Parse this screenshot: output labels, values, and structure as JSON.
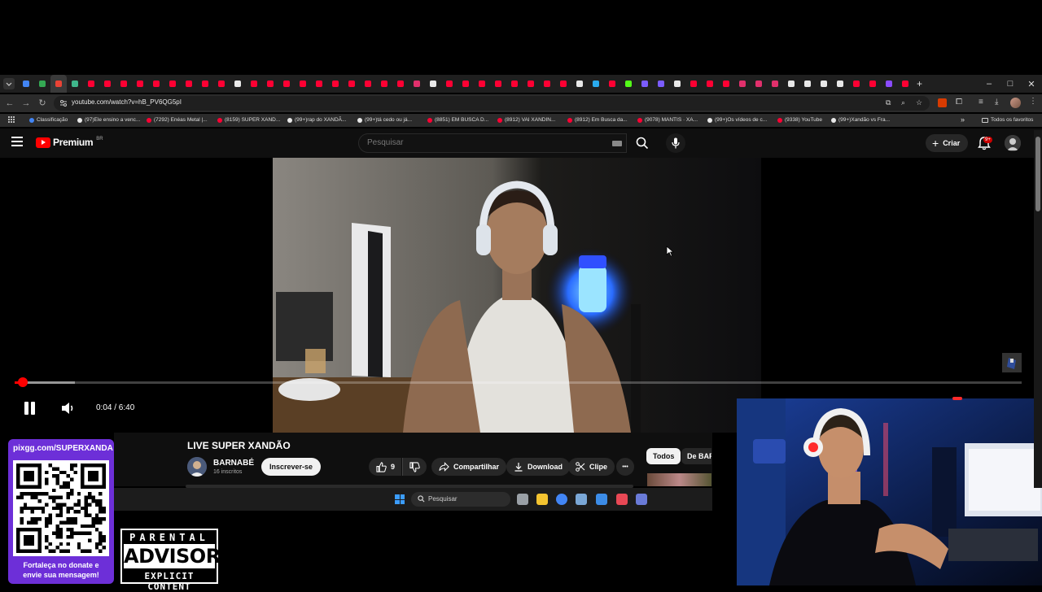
{
  "browser": {
    "tab_favicons": [
      "#4285f4",
      "#34a853",
      "#ea4335",
      "#3fb68b",
      "#ff0033",
      "#ff0033",
      "#ff0033",
      "#ff0033",
      "#ff0033",
      "#ff0033",
      "#ff0033",
      "#ff0033",
      "#ff0033",
      "#e8e8e8",
      "#ff0033",
      "#ff0033",
      "#ff0033",
      "#ff0033",
      "#ff0033",
      "#ff0033",
      "#ff0033",
      "#ff0033",
      "#ff0033",
      "#ff0033",
      "#e1306c",
      "#e8e8e8",
      "#ff0033",
      "#ff0033",
      "#ff0033",
      "#ff0033",
      "#ff0033",
      "#ff0033",
      "#ff0033",
      "#ff0033",
      "#e8e8e8",
      "#2aabee",
      "#ff0033",
      "#53fc18",
      "#7b5cff",
      "#7b5cff",
      "#e8e8e8",
      "#ff0033",
      "#ff0033",
      "#ff0033",
      "#e1306c",
      "#e1306c",
      "#e1306c",
      "#e8e8e8",
      "#e8e8e8",
      "#e8e8e8",
      "#e8e8e8",
      "#ff0033",
      "#ff0033",
      "#8a4bff",
      "#ff0033"
    ],
    "new_tab_label": "+",
    "window_controls": {
      "minimize": "–",
      "maximize": "□",
      "close": "✕"
    },
    "url": "youtube.com/watch?v=hB_PV6QG5pI",
    "bookmarks": [
      {
        "label": "Classificação",
        "color": "#4285f4"
      },
      {
        "label": "(97)Ele ensino a venc...",
        "color": "#e8e8e8"
      },
      {
        "label": "(7292) Enéas Metal |...",
        "color": "#ff0033"
      },
      {
        "label": "(8159) SUPER XAND...",
        "color": "#ff0033"
      },
      {
        "label": "(99+)rap do XANDÃ...",
        "color": "#e8e8e8"
      },
      {
        "label": "(99+)tá cedo ou já...",
        "color": "#e8e8e8"
      },
      {
        "label": "(8851) EM BUSCA D...",
        "color": "#ff0033"
      },
      {
        "label": "(8912) VAI XANDIN...",
        "color": "#ff0033"
      },
      {
        "label": "(8912) Em Busca da...",
        "color": "#ff0033"
      },
      {
        "label": "(9078) MANTIS · XA...",
        "color": "#ff0033"
      },
      {
        "label": "(99+)Os vídeos de c...",
        "color": "#e8e8e8"
      },
      {
        "label": "(9338) YouTube",
        "color": "#ff0033"
      },
      {
        "label": "(99+)Xandão vs Fra...",
        "color": "#e8e8e8"
      }
    ],
    "all_bookmarks": "Todos os favoritos"
  },
  "youtube": {
    "logo_text": "Premium",
    "logo_country": "BR",
    "search_placeholder": "Pesquisar",
    "create_label": "Criar",
    "notifications_badge": "9+",
    "player": {
      "time": "0:04 / 6:40",
      "progress_played_fraction": 0.01,
      "progress_buffered_fraction": 0.06
    },
    "video_title": "LIVE SUPER XANDÃO",
    "channel_name": "BARNABÉ",
    "channel_subs": "16 inscritos",
    "subscribe_label": "Inscrever-se",
    "like_count": "9",
    "share_label": "Compartilhar",
    "download_label": "Download",
    "clip_label": "Clipe",
    "more_label": "•••",
    "chips": [
      "Todos",
      "De BAR"
    ]
  },
  "taskbar": {
    "search_placeholder": "Pesquisar",
    "app_colors": [
      "#9aa0a6",
      "#f4c430",
      "#4285f4",
      "#7aa7d6",
      "#3c8ce7",
      "#e84855",
      "#6a7bd8"
    ]
  },
  "overlay": {
    "donate_url": "pixgg.com/SUPERXANDA",
    "donate_caption": "Fortaleça no donate e envie sua mensagem!",
    "advisory_top": "PARENTAL",
    "advisory_mid": "ADVISORY",
    "advisory_bottom": "EXPLICIT CONTENT"
  },
  "colors": {
    "accent_red": "#ff0000",
    "donate_purple": "#6d2fd8"
  }
}
